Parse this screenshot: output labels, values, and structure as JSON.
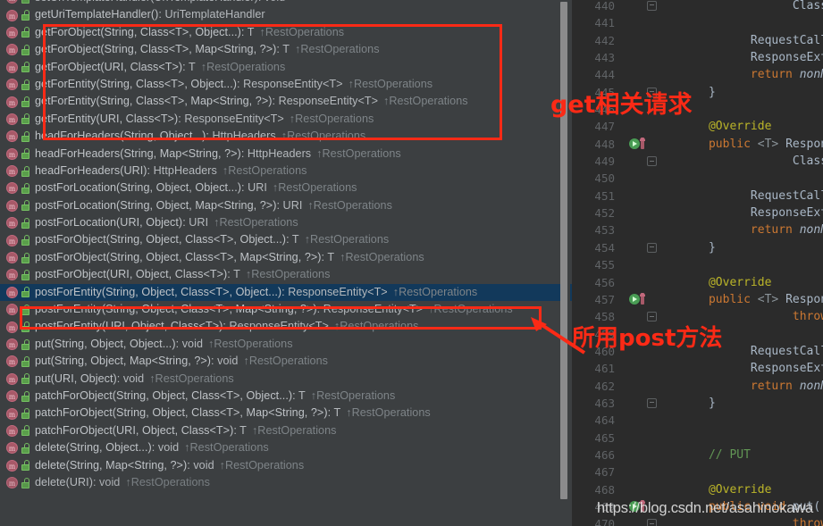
{
  "colors": {
    "annotation_red": "#fb2a16",
    "list_background": "#3c3f41",
    "editor_background": "#2b2b2b",
    "selected_row": "#12395b",
    "method_icon": "#a85968",
    "public_icon": "#5a9e4b"
  },
  "member_list": {
    "panel_name": "structure-member-list",
    "icons": {
      "method": "method-icon",
      "visibility": "public-lock-icon"
    },
    "owner_suffix": "RestOperations",
    "rows": [
      {
        "name": "setUriTemplateHandler(UriTemplateHandler)",
        "ret": ": void",
        "owner": "",
        "selected": false,
        "clipped": true
      },
      {
        "name": "getUriTemplateHandler()",
        "ret": ": UriTemplateHandler",
        "owner": "",
        "selected": false,
        "clipped": false
      },
      {
        "name": "getForObject(String, Class<T>, Object...)",
        "ret": ": T",
        "owner": "RestOperations",
        "selected": false,
        "clipped": false
      },
      {
        "name": "getForObject(String, Class<T>, Map<String, ?>)",
        "ret": ": T",
        "owner": "RestOperations",
        "selected": false,
        "clipped": false
      },
      {
        "name": "getForObject(URI, Class<T>)",
        "ret": ": T",
        "owner": "RestOperations",
        "selected": false,
        "clipped": false
      },
      {
        "name": "getForEntity(String, Class<T>, Object...)",
        "ret": ": ResponseEntity<T>",
        "owner": "RestOperations",
        "selected": false,
        "clipped": false
      },
      {
        "name": "getForEntity(String, Class<T>, Map<String, ?>)",
        "ret": ": ResponseEntity<T>",
        "owner": "RestOperations",
        "selected": false,
        "clipped": false
      },
      {
        "name": "getForEntity(URI, Class<T>)",
        "ret": ": ResponseEntity<T>",
        "owner": "RestOperations",
        "selected": false,
        "clipped": false
      },
      {
        "name": "headForHeaders(String, Object...)",
        "ret": ": HttpHeaders",
        "owner": "RestOperations",
        "selected": false,
        "clipped": false
      },
      {
        "name": "headForHeaders(String, Map<String, ?>)",
        "ret": ": HttpHeaders",
        "owner": "RestOperations",
        "selected": false,
        "clipped": false
      },
      {
        "name": "headForHeaders(URI)",
        "ret": ": HttpHeaders",
        "owner": "RestOperations",
        "selected": false,
        "clipped": false
      },
      {
        "name": "postForLocation(String, Object, Object...)",
        "ret": ": URI",
        "owner": "RestOperations",
        "selected": false,
        "clipped": false
      },
      {
        "name": "postForLocation(String, Object, Map<String, ?>)",
        "ret": ": URI",
        "owner": "RestOperations",
        "selected": false,
        "clipped": false
      },
      {
        "name": "postForLocation(URI, Object)",
        "ret": ": URI",
        "owner": "RestOperations",
        "selected": false,
        "clipped": false
      },
      {
        "name": "postForObject(String, Object, Class<T>, Object...)",
        "ret": ": T",
        "owner": "RestOperations",
        "selected": false,
        "clipped": false
      },
      {
        "name": "postForObject(String, Object, Class<T>, Map<String, ?>)",
        "ret": ": T",
        "owner": "RestOperations",
        "selected": false,
        "clipped": false
      },
      {
        "name": "postForObject(URI, Object, Class<T>)",
        "ret": ": T",
        "owner": "RestOperations",
        "selected": false,
        "clipped": false
      },
      {
        "name": "postForEntity(String, Object, Class<T>, Object...)",
        "ret": ": ResponseEntity<T>",
        "owner": "RestOperations",
        "selected": true,
        "clipped": false
      },
      {
        "name": "postForEntity(String, Object, Class<T>, Map<String, ?>)",
        "ret": ": ResponseEntity<T>",
        "owner": "RestOperations",
        "selected": false,
        "clipped": false
      },
      {
        "name": "postForEntity(URI, Object, Class<T>)",
        "ret": ": ResponseEntity<T>",
        "owner": "RestOperations",
        "selected": false,
        "clipped": false
      },
      {
        "name": "put(String, Object, Object...)",
        "ret": ": void",
        "owner": "RestOperations",
        "selected": false,
        "clipped": false
      },
      {
        "name": "put(String, Object, Map<String, ?>)",
        "ret": ": void",
        "owner": "RestOperations",
        "selected": false,
        "clipped": false
      },
      {
        "name": "put(URI, Object)",
        "ret": ": void",
        "owner": "RestOperations",
        "selected": false,
        "clipped": false
      },
      {
        "name": "patchForObject(String, Object, Class<T>, Object...)",
        "ret": ": T",
        "owner": "RestOperations",
        "selected": false,
        "clipped": false
      },
      {
        "name": "patchForObject(String, Object, Class<T>, Map<String, ?>)",
        "ret": ": T",
        "owner": "RestOperations",
        "selected": false,
        "clipped": false
      },
      {
        "name": "patchForObject(URI, Object, Class<T>)",
        "ret": ": T",
        "owner": "RestOperations",
        "selected": false,
        "clipped": false
      },
      {
        "name": "delete(String, Object...)",
        "ret": ": void",
        "owner": "RestOperations",
        "selected": false,
        "clipped": false
      },
      {
        "name": "delete(String, Map<String, ?>)",
        "ret": ": void",
        "owner": "RestOperations",
        "selected": false,
        "clipped": false
      },
      {
        "name": "delete(URI)",
        "ret": ": void",
        "owner": "RestOperations",
        "selected": false,
        "clipped": true
      }
    ]
  },
  "editor": {
    "panel_name": "code-editor",
    "lines": [
      {
        "no": "440",
        "fold": "end",
        "mark": "",
        "html": "                  <span class='typ'>Class</span><span class='gen'>&lt;T&gt;</span>"
      },
      {
        "no": "441",
        "fold": "",
        "mark": "",
        "html": ""
      },
      {
        "no": "442",
        "fold": "",
        "mark": "",
        "html": "            <span class='typ'>RequestCallba</span>"
      },
      {
        "no": "443",
        "fold": "",
        "mark": "",
        "html": "            <span class='typ'>ResponseExtr</span>"
      },
      {
        "no": "444",
        "fold": "",
        "mark": "",
        "html": "            <span class='kw'>return</span> <span class='itl2'>nonNu</span>"
      },
      {
        "no": "445",
        "fold": "end",
        "mark": "",
        "html": "      }"
      },
      {
        "no": "446",
        "fold": "",
        "mark": "",
        "html": ""
      },
      {
        "no": "447",
        "fold": "",
        "mark": "",
        "html": "      <span class='ann'>@Override</span>"
      },
      {
        "no": "448",
        "fold": "",
        "mark": "run-override",
        "html": "      <span class='kw'>public</span> <span class='gen'>&lt;T&gt;</span> <span class='typ'>Respon</span>"
      },
      {
        "no": "449",
        "fold": "start",
        "mark": "",
        "html": "                  <span class='typ'>Class</span><span class='gen'>&lt;T&gt;</span>"
      },
      {
        "no": "450",
        "fold": "",
        "mark": "",
        "html": ""
      },
      {
        "no": "451",
        "fold": "",
        "mark": "",
        "html": "            <span class='typ'>RequestCallba</span>"
      },
      {
        "no": "452",
        "fold": "",
        "mark": "",
        "html": "            <span class='typ'>ResponseExtr</span>"
      },
      {
        "no": "453",
        "fold": "",
        "mark": "",
        "html": "            <span class='kw'>return</span> <span class='itl2'>nonNu</span>"
      },
      {
        "no": "454",
        "fold": "end",
        "mark": "",
        "html": "      }"
      },
      {
        "no": "455",
        "fold": "",
        "mark": "",
        "html": ""
      },
      {
        "no": "456",
        "fold": "",
        "mark": "",
        "html": "      <span class='ann'>@Override</span>"
      },
      {
        "no": "457",
        "fold": "",
        "mark": "run-override",
        "html": "      <span class='kw'>public</span> <span class='gen'>&lt;T&gt;</span> <span class='typ'>Respon</span>"
      },
      {
        "no": "458",
        "fold": "start",
        "mark": "",
        "html": "                  <span class='kw'>throws</span> <span class='typ'>R</span>"
      },
      {
        "no": "459",
        "fold": "",
        "mark": "",
        "html": ""
      },
      {
        "no": "460",
        "fold": "",
        "mark": "",
        "html": "            <span class='typ'>RequestCallba</span>"
      },
      {
        "no": "461",
        "fold": "",
        "mark": "",
        "html": "            <span class='typ'>ResponseExtr</span>"
      },
      {
        "no": "462",
        "fold": "",
        "mark": "",
        "html": "            <span class='kw'>return</span> <span class='itl2'>nonNu</span>"
      },
      {
        "no": "463",
        "fold": "end",
        "mark": "",
        "html": "      }"
      },
      {
        "no": "464",
        "fold": "",
        "mark": "",
        "html": ""
      },
      {
        "no": "465",
        "fold": "",
        "mark": "",
        "html": ""
      },
      {
        "no": "466",
        "fold": "",
        "mark": "",
        "html": "      <span class='cmt'>// PUT</span>"
      },
      {
        "no": "467",
        "fold": "",
        "mark": "",
        "html": ""
      },
      {
        "no": "468",
        "fold": "",
        "mark": "",
        "html": "      <span class='ann'>@Override</span>"
      },
      {
        "no": "469",
        "fold": "",
        "mark": "run-override",
        "html": "      <span class='kw'>public</span> <span class='kw'>void</span> <span class='typ'>put(</span>"
      },
      {
        "no": "470",
        "fold": "start",
        "mark": "",
        "html": "                  <span class='kw'>throws</span> <span class='typ'>R</span>"
      }
    ]
  },
  "annotations": {
    "get_label": "get相关请求",
    "post_label": "所用post方法"
  },
  "watermark": {
    "text": "https://blog.csdn.net/asahinokawa"
  }
}
